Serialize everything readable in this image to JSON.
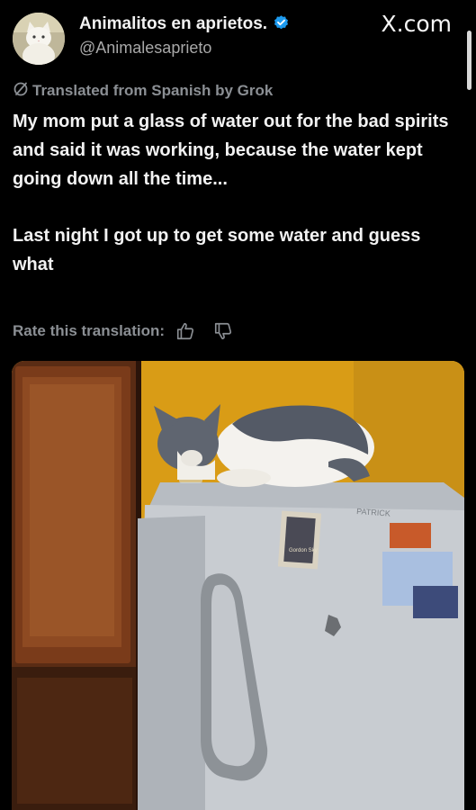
{
  "account": {
    "display_name": "Animalitos en aprietos.",
    "handle": "@Animalesaprieto",
    "avatar_icon": "cat-avatar-icon",
    "verified_icon": "verified-badge-icon",
    "verified_color": "#1d9bf0"
  },
  "watermark": {
    "site_label": "X.com"
  },
  "translation": {
    "notice": "Translated from Spanish by Grok",
    "notice_icon": "grok-slash-icon",
    "rate_label": "Rate this translation:",
    "thumbs_up_icon": "thumbs-up-icon",
    "thumbs_down_icon": "thumbs-down-icon"
  },
  "tweet": {
    "paragraph_1": "My mom put a glass of water out for the bad spirits and said it was working, because the water kept going down all the time...",
    "paragraph_2": "Last night I got up to get some water and guess what"
  },
  "media": {
    "brand_label": "PATRICK",
    "magnet_text": "Gordon Sky"
  },
  "colors": {
    "background": "#000000",
    "text_primary": "#f2f2f2",
    "text_secondary": "#8b8f94",
    "wall_yellow": "#e0a41c",
    "fridge_gray": "#c9cdd2"
  }
}
